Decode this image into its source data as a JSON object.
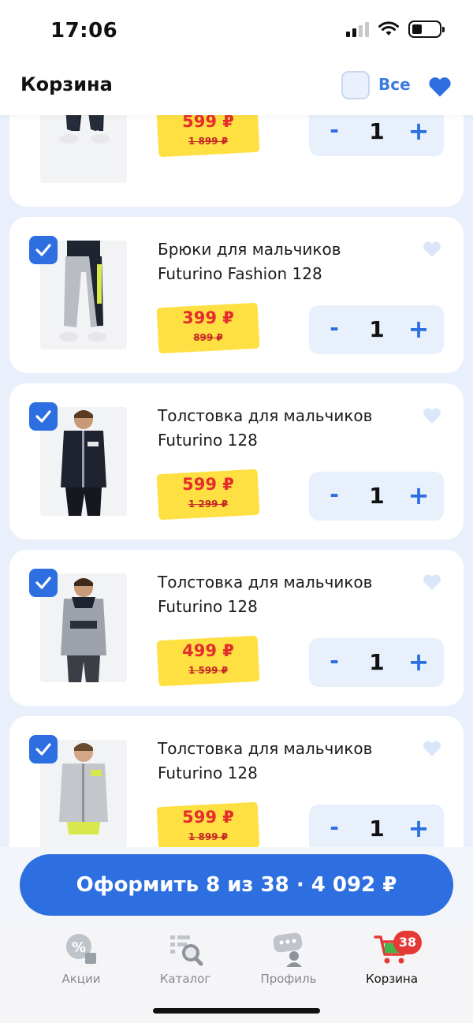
{
  "status": {
    "time": "17:06"
  },
  "header": {
    "title": "Корзина",
    "all_label": "Все"
  },
  "items": [
    {
      "name": "",
      "price": "599 ₽",
      "old_price": "1 899 ₽",
      "qty": "1"
    },
    {
      "name": "Брюки для мальчиков Futurino Fashion 128",
      "price": "399 ₽",
      "old_price": "899 ₽",
      "qty": "1"
    },
    {
      "name": "Толстовка для мальчиков Futurino 128",
      "price": "599 ₽",
      "old_price": "1 299 ₽",
      "qty": "1"
    },
    {
      "name": "Толстовка для мальчиков Futurino 128",
      "price": "499 ₽",
      "old_price": "1 599 ₽",
      "qty": "1"
    },
    {
      "name": "Толстовка для мальчиков Futurino 128",
      "price": "599 ₽",
      "old_price": "1 899 ₽",
      "qty": "1"
    }
  ],
  "stepper": {
    "minus": "-",
    "plus": "+"
  },
  "checkout": {
    "label": "Оформить 8 из 38 · 4 092 ₽"
  },
  "tabbar": {
    "items": [
      {
        "label": "Акции",
        "icon": "percent-tag-icon"
      },
      {
        "label": "Каталог",
        "icon": "catalog-search-icon"
      },
      {
        "label": "Профиль",
        "icon": "profile-icon"
      },
      {
        "label": "Корзина",
        "icon": "cart-icon"
      }
    ],
    "badge": "38"
  },
  "colors": {
    "accent": "#2d6fe0",
    "price_tag": "#ffe043",
    "price_red": "#e52d2d",
    "background": "#e9f0fb"
  }
}
